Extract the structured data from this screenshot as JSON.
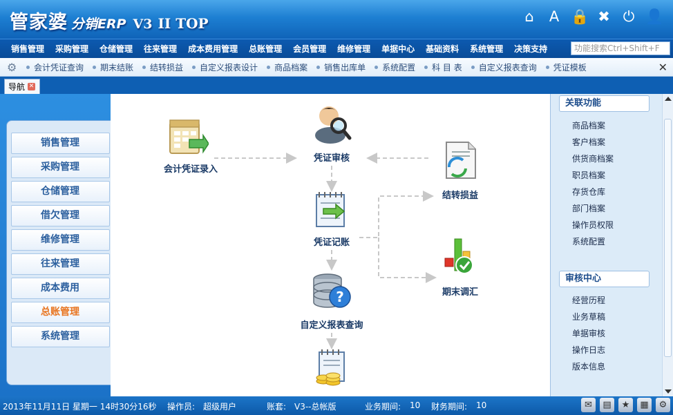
{
  "app": {
    "logo_part1": "管家婆",
    "logo_part2": "分销ERP",
    "logo_part3": "V3",
    "logo_part4": "II TOP"
  },
  "title_icons": [
    {
      "name": "home-icon",
      "glyph": "⌂"
    },
    {
      "name": "font-size-icon",
      "glyph": "A"
    },
    {
      "name": "lock-icon",
      "glyph": "🔒"
    },
    {
      "name": "close-circle-icon",
      "glyph": "✖"
    },
    {
      "name": "power-icon",
      "glyph": "⏻"
    },
    {
      "name": "user-icon",
      "glyph": "👤"
    }
  ],
  "menu": [
    "销售管理",
    "采购管理",
    "仓储管理",
    "往来管理",
    "成本费用管理",
    "总账管理",
    "会员管理",
    "维修管理",
    "单据中心",
    "基础资料",
    "系统管理",
    "决策支持"
  ],
  "search": {
    "placeholder": "功能搜索Ctrl+Shift+F"
  },
  "shortcuts": [
    "会计凭证查询",
    "期末结账",
    "结转损益",
    "自定义报表设计",
    "商品档案",
    "销售出库单",
    "系统配置",
    "科 目 表",
    "自定义报表查询",
    "凭证模板"
  ],
  "tab": {
    "label": "导航"
  },
  "left_nav": [
    "销售管理",
    "采购管理",
    "仓储管理",
    "借欠管理",
    "维修管理",
    "往来管理",
    "成本费用",
    "总账管理",
    "系统管理"
  ],
  "left_nav_active": "总账管理",
  "flow": {
    "voucher_entry": "会计凭证录入",
    "voucher_audit": "凭证审核",
    "profit_transfer": "结转损益",
    "voucher_post": "凭证记账",
    "period_adjust": "期末调汇",
    "custom_report": "自定义报表查询"
  },
  "right_panel": {
    "section1": {
      "title": "关联功能",
      "items": [
        "商品档案",
        "客户档案",
        "供货商档案",
        "职员档案",
        "存货仓库",
        "部门档案",
        "操作员权限",
        "系统配置"
      ]
    },
    "section2": {
      "title": "审核中心",
      "items": [
        "经营历程",
        "业务草稿",
        "单据审核",
        "操作日志",
        "版本信息"
      ]
    }
  },
  "status": {
    "datetime": "2013年11月11日 星期一 14时30分16秒",
    "operator_label": "操作员:",
    "operator": "超级用户",
    "account_label": "账套:",
    "account": "V3--总帐版",
    "business_period_label": "业务期间:",
    "business_period": "10",
    "finance_period_label": "财务期间:",
    "finance_period": "10"
  },
  "colors": {
    "title_blue": "#1d7fd2",
    "menu_blue": "#0a4c98",
    "active_nav": "#e8741f",
    "nav_text": "#2b5f9e"
  }
}
